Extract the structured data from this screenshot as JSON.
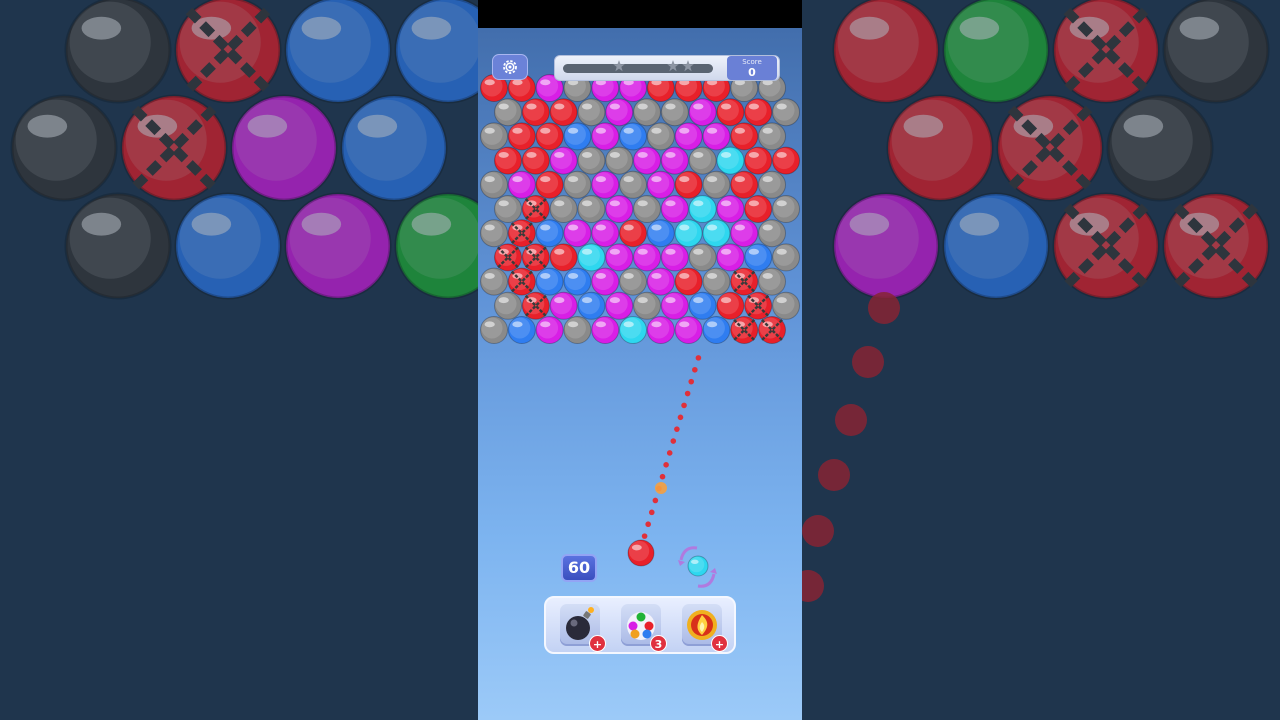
{
  "game": {
    "score_label": "Score",
    "score_value": "0",
    "moves_left": "60",
    "level_progress": 0,
    "star_count": 3
  },
  "colors": {
    "red": "#e8202a",
    "green": "#21b336",
    "magenta": "#d81ee6",
    "blue": "#2f7df0",
    "cyan": "#2ed7ef",
    "gray": "#8a8a8a",
    "dark": "#3a3a3a"
  },
  "board": {
    "rows": [
      "RRPGPPRRRGG",
      "GRRGPGGPRRG",
      "GRRBPBGPPRG",
      "RRPGGPPGCRR",
      "GPRGPGPRGRG",
      "GXGGPGPCPRG",
      "GXBPPRBCCPG",
      "XXRCPPPGPBG",
      "GXBBPGPRGXG",
      "GXPBPGPBRXG",
      "GBPGPCPPBXX"
    ]
  },
  "background_bubbles": {
    "left": [
      "dark",
      "chained",
      "blue",
      "blue",
      "dark",
      "chained",
      "magenta",
      "blue",
      "dark",
      "blue",
      "magenta",
      "green"
    ],
    "right": [
      "red",
      "green",
      "chained",
      "dark",
      "red",
      "chained",
      "dark",
      "magenta",
      "blue",
      "chained",
      "chained"
    ]
  },
  "shooter": {
    "current_color": "red",
    "next_color": "cyan"
  },
  "boosters": [
    {
      "name": "bomb",
      "icon": "bomb-icon",
      "count": "+"
    },
    {
      "name": "rainbow",
      "icon": "rainbow-balls-icon",
      "count": "3"
    },
    {
      "name": "fireball",
      "icon": "fireball-icon",
      "count": "+"
    }
  ]
}
